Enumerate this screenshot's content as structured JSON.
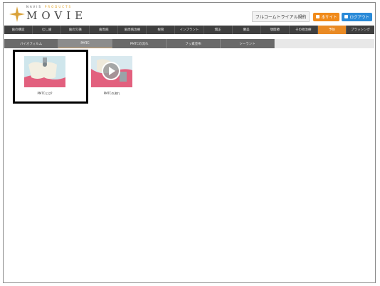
{
  "brand": {
    "top_line": "NAVIS",
    "top_sub": "PRODUCTS",
    "name": "MOVIE"
  },
  "header": {
    "trial_text": "フルコームトライアル規約",
    "site_button": "本サイト",
    "logout_button": "ログアウト"
  },
  "main_nav": [
    {
      "label": "歯の構造",
      "active": false
    },
    {
      "label": "むし歯",
      "active": false
    },
    {
      "label": "歯の欠損",
      "active": false
    },
    {
      "label": "歯周病",
      "active": false
    },
    {
      "label": "歯周病治療",
      "active": false
    },
    {
      "label": "根管",
      "active": false
    },
    {
      "label": "インプラント",
      "active": false
    },
    {
      "label": "矯正",
      "active": false
    },
    {
      "label": "審美",
      "active": false
    },
    {
      "label": "顎関節",
      "active": false
    },
    {
      "label": "その他治療",
      "active": false
    },
    {
      "label": "予防",
      "active": true
    },
    {
      "label": "ブラッシング",
      "active": false
    }
  ],
  "sub_nav": [
    {
      "label": "バイオフィルム",
      "active": false
    },
    {
      "label": "PMTC",
      "active": true
    },
    {
      "label": "PMTCの流れ",
      "active": false
    },
    {
      "label": "フッ素塗布",
      "active": false
    },
    {
      "label": "シーラント",
      "active": false
    }
  ],
  "videos": [
    {
      "caption": "PMTCとは?",
      "selected": true
    },
    {
      "caption": "PMTCの流れ",
      "selected": false
    }
  ],
  "colors": {
    "accent": "#e98a24",
    "nav_bg": "#3f3f3f",
    "subnav_bg": "#6a6a6a",
    "thumb_gum": "#e2607e",
    "logout_blue": "#2a8ad8"
  }
}
